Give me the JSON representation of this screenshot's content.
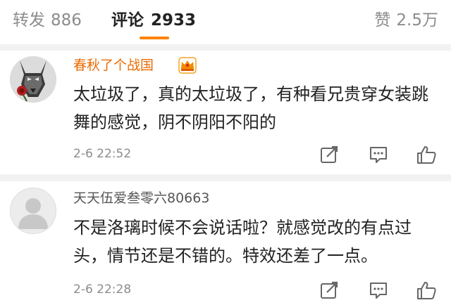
{
  "tabs": {
    "repost": {
      "label": "转发",
      "count": "886"
    },
    "comments": {
      "label": "评论",
      "count": "2933"
    },
    "likes": {
      "label": "赞",
      "count": "2.5万"
    }
  },
  "colors": {
    "accent": "#ff8200",
    "vip_name": "#eb6a00",
    "muted_text": "#8c8c8c",
    "divider": "#f2f2f2"
  },
  "comments": [
    {
      "username": "春秋了个战国",
      "vip": true,
      "avatar_icon": "wolf-rose-avatar",
      "text": "太垃圾了，真的太垃圾了，有种看兄贵穿女装跳舞的感觉，阴不阴阳不阳的",
      "time": "2-6 22:52",
      "actions": [
        "repost-icon",
        "reply-icon",
        "like-icon"
      ]
    },
    {
      "username": "天天伍爱叁零六80663",
      "vip": false,
      "avatar_icon": "default-avatar",
      "text": "不是洛璃时候不会说话啦？就感觉改的有点过头，情节还是不错的。特效还差了一点。",
      "time": "2-6 22:28",
      "actions": [
        "repost-icon",
        "reply-icon",
        "like-icon"
      ]
    }
  ]
}
